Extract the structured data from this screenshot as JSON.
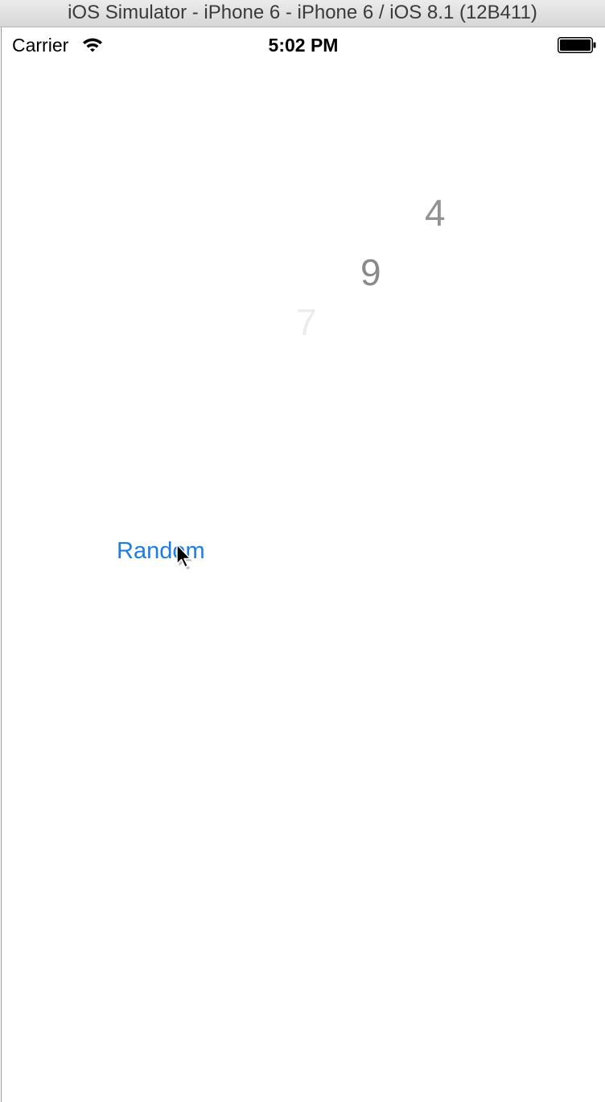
{
  "window": {
    "title": "iOS Simulator - iPhone 6 - iPhone 6 / iOS 8.1 (12B411)"
  },
  "status_bar": {
    "carrier": "Carrier",
    "wifi_icon": "wifi-icon",
    "time": "5:02 PM",
    "battery_icon": "battery-icon",
    "battery_level": 1.0
  },
  "content": {
    "numbers": [
      "4",
      "9",
      "7"
    ],
    "random_button_label": "Random",
    "random_button_color": "#1d7de0"
  },
  "cursor": {
    "icon": "mouse-pointer-icon"
  }
}
